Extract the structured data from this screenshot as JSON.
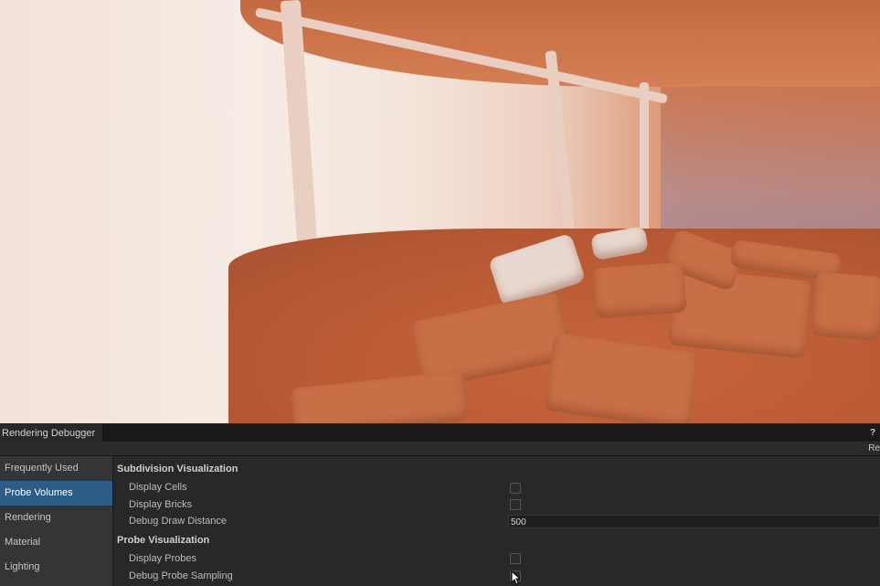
{
  "window": {
    "tab_title": "Rendering Debugger",
    "help_glyph": "?",
    "reset_label": "Re"
  },
  "sidebar": {
    "items": [
      {
        "label": "Frequently Used",
        "active": false
      },
      {
        "label": "Probe Volumes",
        "active": true
      },
      {
        "label": "Rendering",
        "active": false
      },
      {
        "label": "Material",
        "active": false
      },
      {
        "label": "Lighting",
        "active": false
      }
    ]
  },
  "panel": {
    "subdivision": {
      "title": "Subdivision Visualization",
      "display_cells": {
        "label": "Display Cells",
        "checked": false
      },
      "display_bricks": {
        "label": "Display Bricks",
        "checked": false
      },
      "debug_draw_distance": {
        "label": "Debug Draw Distance",
        "value": "500"
      }
    },
    "probes": {
      "title": "Probe Visualization",
      "display_probes": {
        "label": "Display Probes",
        "checked": false
      },
      "debug_probe_sampling": {
        "label": "Debug Probe Sampling",
        "checked": false
      }
    }
  },
  "colors": {
    "active_item": "#2c5d87",
    "panel_bg": "#282828",
    "sidebar_bg": "#353535"
  }
}
